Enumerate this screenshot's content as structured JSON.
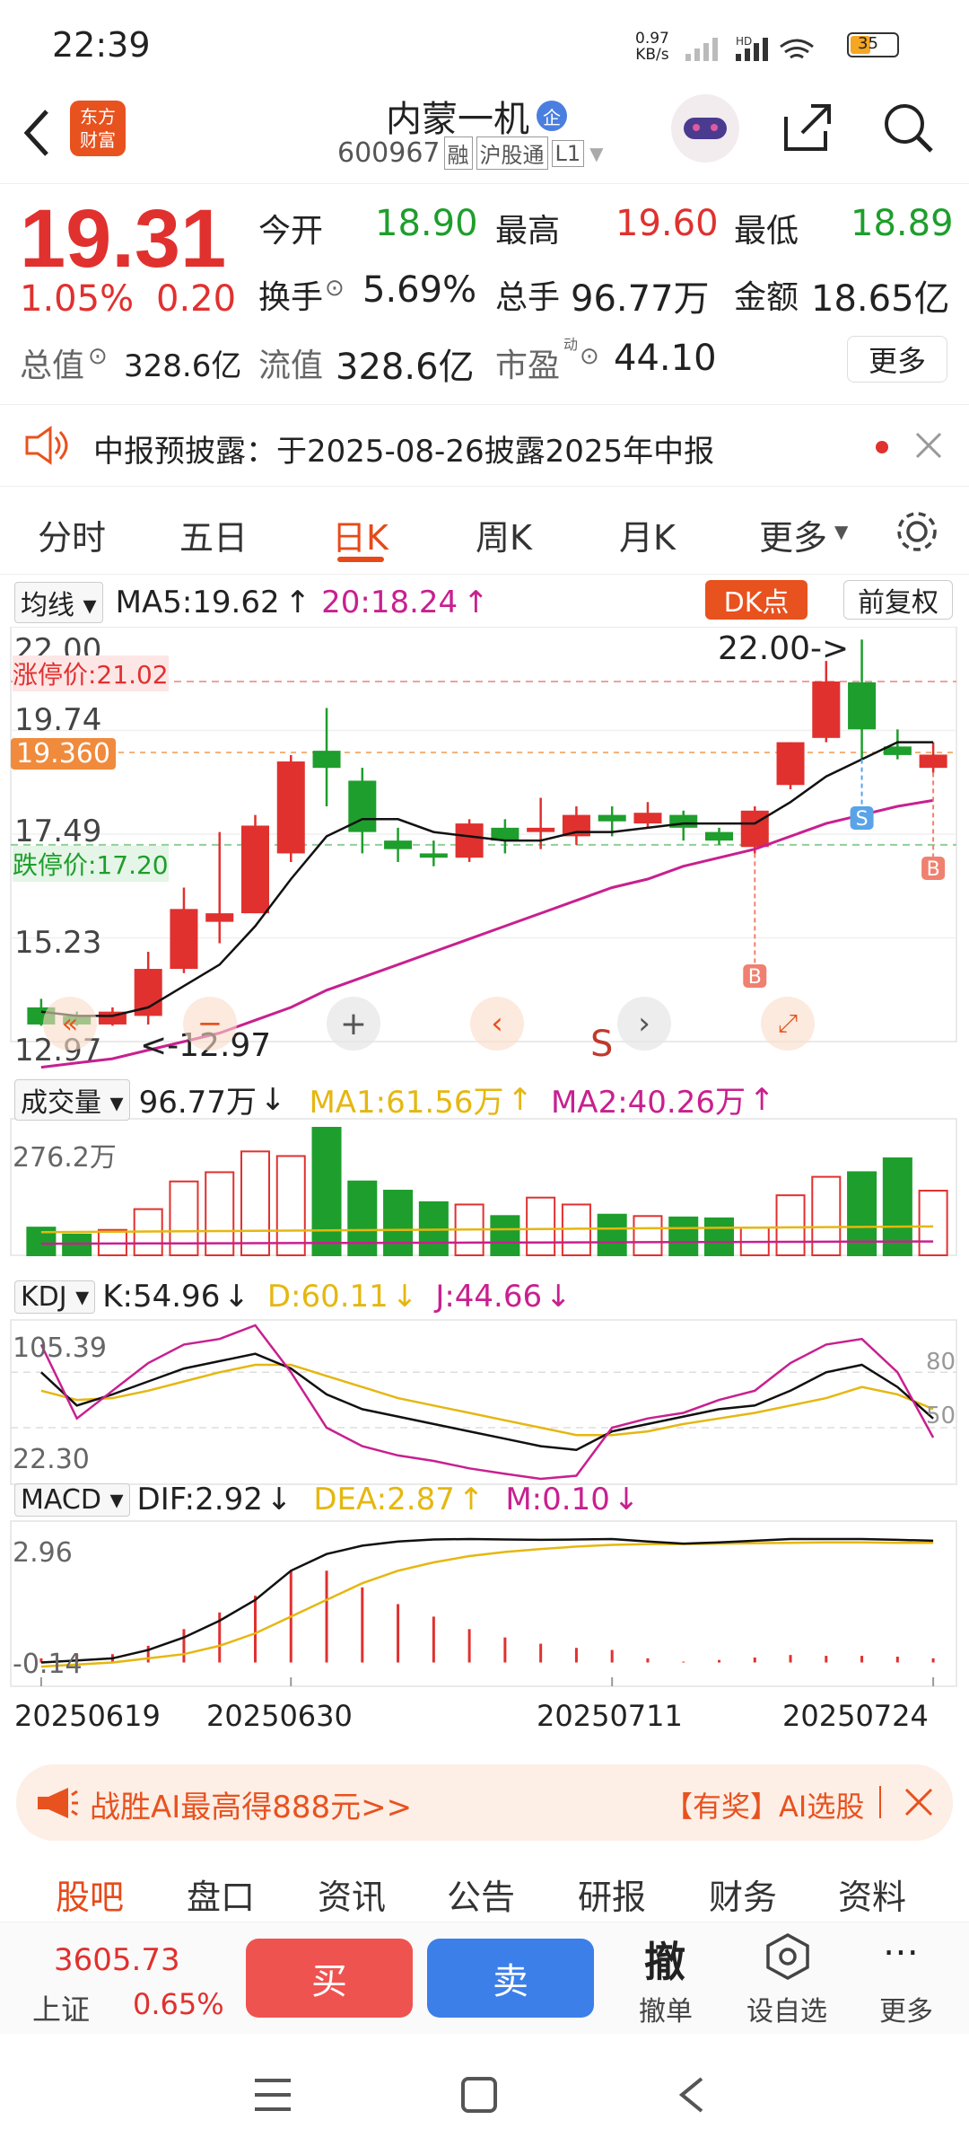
{
  "status": {
    "time": "22:39",
    "net_speed_value": "0.97",
    "net_speed_unit": "KB/s",
    "battery": "35"
  },
  "header": {
    "logo_line1": "东方",
    "logo_line2": "财富",
    "title": "内蒙一机",
    "badge": "企",
    "code": "600967",
    "tag1": "融",
    "tag2": "沪股通",
    "tag3": "L1"
  },
  "quote": {
    "price": "19.31",
    "pct": "1.05%",
    "chg": "0.20",
    "open_label": "今开",
    "open": "18.90",
    "high_label": "最高",
    "high": "19.60",
    "low_label": "最低",
    "low": "18.89",
    "turnover_label": "换手",
    "turnover": "5.69%",
    "volume_label": "总手",
    "volume": "96.77万",
    "amount_label": "金额",
    "amount": "18.65亿",
    "mcap_label": "总值",
    "mcap": "328.6亿",
    "float_label": "流值",
    "float_cap": "328.6亿",
    "pe_label": "市盈",
    "pe_sup": "动",
    "pe": "44.10",
    "more": "更多"
  },
  "notice": {
    "text": "中报预披露：于2025-08-26披露2025年中报"
  },
  "tabs": [
    "分时",
    "五日",
    "日K",
    "周K",
    "月K",
    "更多"
  ],
  "active_tab": "日K",
  "kline": {
    "ma_select": "均线",
    "ma5": "MA5:19.62",
    "ma5_arrow": "↑",
    "ma20": "20:18.24",
    "ma20_arrow": "↑",
    "dk_btn": "DK点",
    "adjust_btn": "前复权",
    "y_22": "22.00",
    "y_1974": "19.74",
    "y_1749": "17.49",
    "y_1523": "15.23",
    "y_1297": "12.97",
    "limit_up": "涨停价:21.02",
    "limit_down": "跌停价:17.20",
    "cur_price": "19.360",
    "high_marker": "22.00->",
    "low_marker": "<-12.97",
    "s_mark": "S",
    "b_mark": "B"
  },
  "volume": {
    "select": "成交量",
    "val": "96.77万",
    "val_arrow": "↓",
    "ma1": "MA1:61.56万",
    "ma1_arrow": "↑",
    "ma2": "MA2:40.26万",
    "ma2_arrow": "↑",
    "ymax": "276.2万"
  },
  "kdj": {
    "select": "KDJ",
    "k": "K:54.96",
    "k_arrow": "↓",
    "d": "D:60.11",
    "d_arrow": "↓",
    "j": "J:44.66",
    "j_arrow": "↓",
    "ymax": "105.39",
    "ymin": "22.30",
    "ref80": "80",
    "ref50": "50"
  },
  "macd": {
    "select": "MACD",
    "dif": "DIF:2.92",
    "dif_arrow": "↓",
    "dea": "DEA:2.87",
    "dea_arrow": "↑",
    "m": "M:0.10",
    "m_arrow": "↓",
    "ymax": "2.96",
    "ymin": "-0.14"
  },
  "dates": [
    "20250619",
    "20250630",
    "20250711",
    "20250724"
  ],
  "promo": {
    "text": "战胜AI最高得888元>>",
    "right": "【有奖】AI选股"
  },
  "bottom_tabs": [
    "股吧",
    "盘口",
    "资讯",
    "公告",
    "研报",
    "财务",
    "资料"
  ],
  "trade": {
    "index_value": "3605.73",
    "index_name": "上证",
    "index_pct": "0.65%",
    "buy": "买",
    "sell": "卖",
    "cancel_icon": "撤",
    "cancel": "撤单",
    "watch": "设自选",
    "more": "更多"
  },
  "chart_data": {
    "type": "candlestick",
    "x": [
      "20250619",
      "",
      "",
      "",
      "",
      "",
      "20250630",
      "",
      "",
      "",
      "",
      "",
      "",
      "",
      "",
      "20250711",
      "",
      "",
      "",
      "",
      "",
      "",
      "",
      "",
      "20250724"
    ],
    "candles": [
      {
        "o": 13.4,
        "c": 13.0,
        "h": 13.6,
        "l": 12.97
      },
      {
        "o": 13.2,
        "c": 13.0,
        "h": 13.3,
        "l": 12.97
      },
      {
        "o": 13.0,
        "c": 13.3,
        "h": 13.4,
        "l": 12.97
      },
      {
        "o": 13.2,
        "c": 14.3,
        "h": 14.7,
        "l": 13.0
      },
      {
        "o": 14.3,
        "c": 15.7,
        "h": 16.2,
        "l": 14.2
      },
      {
        "o": 15.4,
        "c": 15.6,
        "h": 17.5,
        "l": 14.9
      },
      {
        "o": 15.6,
        "c": 17.65,
        "h": 17.9,
        "l": 15.6
      },
      {
        "o": 17.0,
        "c": 19.15,
        "h": 19.3,
        "l": 16.8
      },
      {
        "o": 19.4,
        "c": 19.0,
        "h": 20.4,
        "l": 18.1
      },
      {
        "o": 18.7,
        "c": 17.5,
        "h": 19.0,
        "l": 17.0
      },
      {
        "o": 17.3,
        "c": 17.1,
        "h": 17.6,
        "l": 16.8
      },
      {
        "o": 17.0,
        "c": 16.9,
        "h": 17.3,
        "l": 16.7
      },
      {
        "o": 16.9,
        "c": 17.7,
        "h": 17.8,
        "l": 16.8
      },
      {
        "o": 17.6,
        "c": 17.3,
        "h": 17.8,
        "l": 17.0
      },
      {
        "o": 17.5,
        "c": 17.6,
        "h": 18.3,
        "l": 17.1
      },
      {
        "o": 17.4,
        "c": 17.9,
        "h": 18.1,
        "l": 17.2
      },
      {
        "o": 17.9,
        "c": 17.75,
        "h": 18.1,
        "l": 17.4
      },
      {
        "o": 17.7,
        "c": 17.95,
        "h": 18.2,
        "l": 17.6
      },
      {
        "o": 17.9,
        "c": 17.6,
        "h": 18.0,
        "l": 17.3
      },
      {
        "o": 17.5,
        "c": 17.3,
        "h": 17.6,
        "l": 17.2
      },
      {
        "o": 17.15,
        "c": 18.0,
        "h": 18.1,
        "l": 17.0
      },
      {
        "o": 18.6,
        "c": 19.6,
        "h": 19.6,
        "l": 18.5
      },
      {
        "o": 19.7,
        "c": 21.02,
        "h": 21.5,
        "l": 19.6
      },
      {
        "o": 21.0,
        "c": 19.9,
        "h": 22.0,
        "l": 19.2
      },
      {
        "o": 19.5,
        "c": 19.3,
        "h": 19.9,
        "l": 19.2
      },
      {
        "o": 19.0,
        "c": 19.31,
        "h": 19.6,
        "l": 18.89
      }
    ],
    "ma5": [
      13.3,
      13.2,
      13.2,
      13.4,
      13.9,
      14.4,
      15.3,
      16.4,
      17.4,
      17.8,
      17.8,
      17.5,
      17.4,
      17.3,
      17.3,
      17.5,
      17.5,
      17.6,
      17.7,
      17.7,
      17.7,
      18.2,
      18.8,
      19.2,
      19.6,
      19.6
    ],
    "ma20": [
      12.0,
      12.1,
      12.2,
      12.4,
      12.6,
      12.8,
      13.1,
      13.4,
      13.8,
      14.1,
      14.4,
      14.7,
      15.0,
      15.3,
      15.6,
      15.9,
      16.2,
      16.4,
      16.7,
      16.9,
      17.1,
      17.4,
      17.7,
      17.9,
      18.1,
      18.24
    ],
    "volume_wan": [
      60,
      45,
      55,
      100,
      160,
      180,
      225,
      215,
      276.2,
      160,
      140,
      115,
      110,
      85,
      125,
      110,
      88,
      85,
      82,
      80,
      60,
      130,
      170,
      180,
      210,
      140,
      96.77
    ],
    "kdj": {
      "K": [
        80,
        62,
        68,
        75,
        82,
        86,
        90,
        82,
        68,
        60,
        56,
        52,
        48,
        44,
        40,
        38,
        48,
        52,
        56,
        60,
        62,
        70,
        80,
        84,
        72,
        54.96
      ],
      "D": [
        70,
        65,
        66,
        70,
        75,
        80,
        84,
        84,
        78,
        72,
        66,
        62,
        58,
        54,
        50,
        46,
        46,
        48,
        52,
        55,
        58,
        62,
        66,
        72,
        68,
        60.11
      ],
      "J": [
        95,
        55,
        70,
        85,
        95,
        98,
        105.39,
        80,
        50,
        40,
        35,
        32,
        28,
        25,
        22.3,
        24,
        50,
        55,
        58,
        65,
        70,
        85,
        95,
        98,
        80,
        44.66
      ]
    },
    "macd": {
      "DIF": [
        0.0,
        0.05,
        0.1,
        0.3,
        0.6,
        1.0,
        1.5,
        2.2,
        2.6,
        2.8,
        2.9,
        2.95,
        2.96,
        2.95,
        2.94,
        2.95,
        2.96,
        2.9,
        2.85,
        2.88,
        2.92,
        2.96,
        2.96,
        2.96,
        2.94,
        2.92
      ],
      "DEA": [
        -0.1,
        -0.05,
        0.0,
        0.1,
        0.2,
        0.4,
        0.7,
        1.1,
        1.5,
        1.9,
        2.2,
        2.4,
        2.55,
        2.65,
        2.72,
        2.78,
        2.82,
        2.84,
        2.84,
        2.85,
        2.86,
        2.87,
        2.88,
        2.88,
        2.87,
        2.87
      ],
      "M": [
        0.1,
        0.2,
        0.2,
        0.4,
        0.8,
        1.2,
        1.6,
        2.2,
        2.2,
        1.8,
        1.4,
        1.1,
        0.8,
        0.6,
        0.45,
        0.35,
        0.3,
        0.1,
        0.02,
        0.06,
        0.12,
        0.18,
        0.16,
        0.16,
        0.14,
        0.1
      ]
    }
  }
}
